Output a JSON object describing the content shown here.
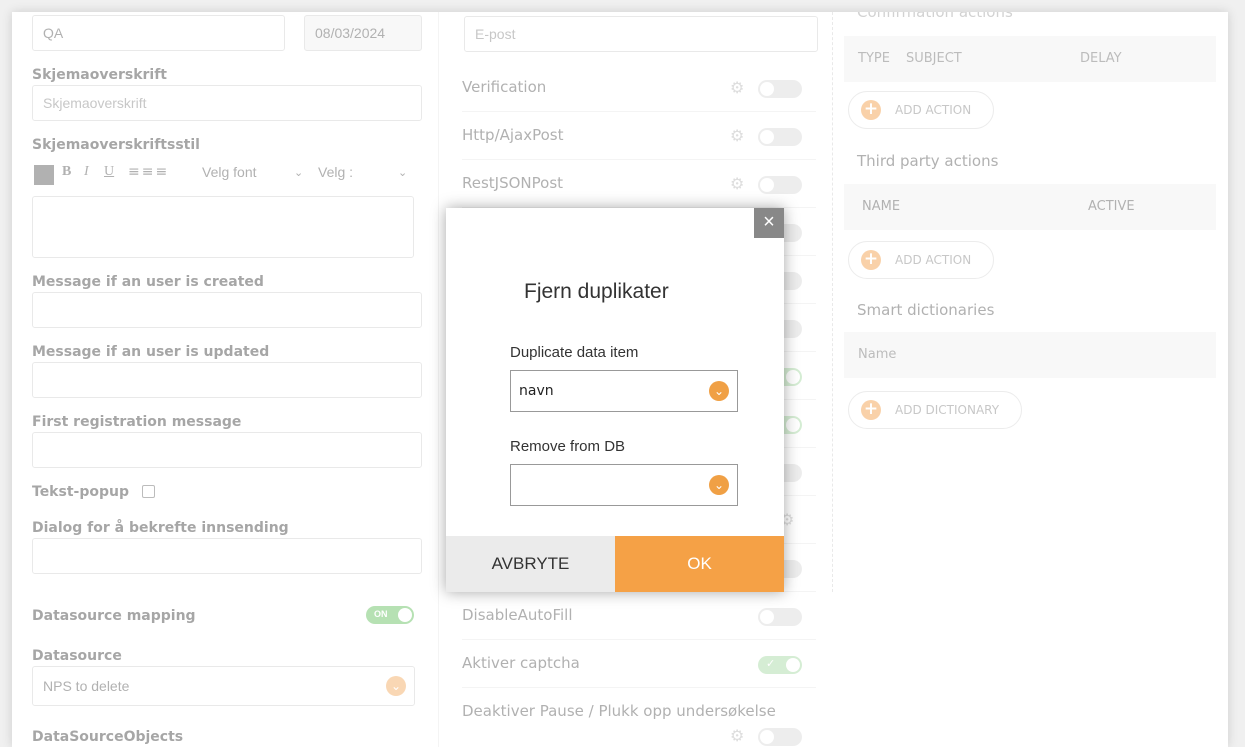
{
  "left": {
    "row1_value": "QA",
    "row1_date": "08/03/2024",
    "form_heading_label": "Skjemaoverskrift",
    "form_heading_placeholder": "Skjemaoverskrift",
    "heading_style_label": "Skjemaoverskriftsstil",
    "toolbar": {
      "bold": "B",
      "italic": "I",
      "underline": "U",
      "font_select": "Velg font",
      "size_select": "Velg :"
    },
    "msg_created_label": "Message if an user is created",
    "msg_updated_label": "Message if an user is updated",
    "first_reg_label": "First registration message",
    "text_popup_label": "Tekst-popup",
    "confirm_dialog_label": "Dialog for å bekrefte innsending",
    "ds_mapping_label": "Datasource mapping",
    "ds_mapping_toggle": "ON",
    "datasource_label": "Datasource",
    "datasource_value": "NPS to delete",
    "ds_objects_label": "DataSourceObjects"
  },
  "middle": {
    "email_placeholder": "E-post",
    "rows": [
      {
        "name": "Verification"
      },
      {
        "name": "Http/AjaxPost"
      },
      {
        "name": "RestJSONPost"
      },
      {
        "name": "DisableAutoFill"
      },
      {
        "name": "Aktiver captcha"
      },
      {
        "name": "Deaktiver Pause / Plukk opp undersøkelse"
      }
    ]
  },
  "right": {
    "confirmation_title": "Confirmation actions",
    "conf_cols": [
      "TYPE",
      "SUBJECT",
      "DELAY"
    ],
    "add_action": "ADD ACTION",
    "third_party_title": "Third party actions",
    "tp_cols": [
      "NAME",
      "ACTIVE"
    ],
    "add_action_2": "ADD ACTION",
    "smart_dict_title": "Smart dictionaries",
    "sd_col": "Name",
    "add_dictionary": "ADD DICTIONARY"
  },
  "modal": {
    "title": "Fjern duplikater",
    "field1_label": "Duplicate data item",
    "field1_value": "navn",
    "field2_label": "Remove from DB",
    "field2_value": "",
    "cancel": "AVBRYTE",
    "ok": "OK",
    "close": "×"
  },
  "colors": {
    "accent": "#f5a146",
    "toggle_on": "#bfe3bd",
    "close_bg": "#888888"
  }
}
